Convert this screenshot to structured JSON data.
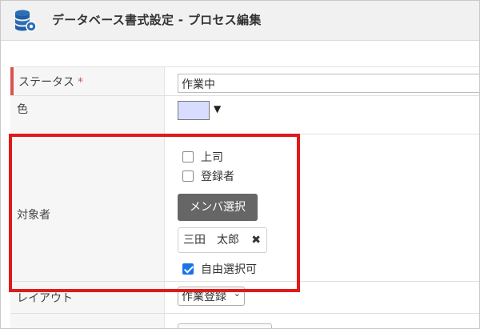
{
  "header": {
    "title": "データベース書式設定 - プロセス編集",
    "icon": "database-gear-icon"
  },
  "form": {
    "status": {
      "label": "ステータス",
      "required_mark": "*",
      "value": "作業中"
    },
    "color": {
      "label": "色",
      "value": "#d8dcff",
      "arrow": "▼"
    },
    "target": {
      "label": "対象者",
      "options": [
        {
          "label": "上司",
          "checked": false
        },
        {
          "label": "登録者",
          "checked": false
        }
      ],
      "member_button": "メンバ選択",
      "selected_member": "三田　太郎",
      "remove_glyph": "✖",
      "free_select": {
        "label": "自由選択可",
        "checked": true
      }
    },
    "layout": {
      "label": "レイアウト",
      "value": "作業登録",
      "arrow": "⌄"
    }
  },
  "colors": {
    "highlight": "#e01a1a",
    "required": "#d9534f",
    "checkbox_checked": "#1a73e8",
    "button": "#666666"
  }
}
